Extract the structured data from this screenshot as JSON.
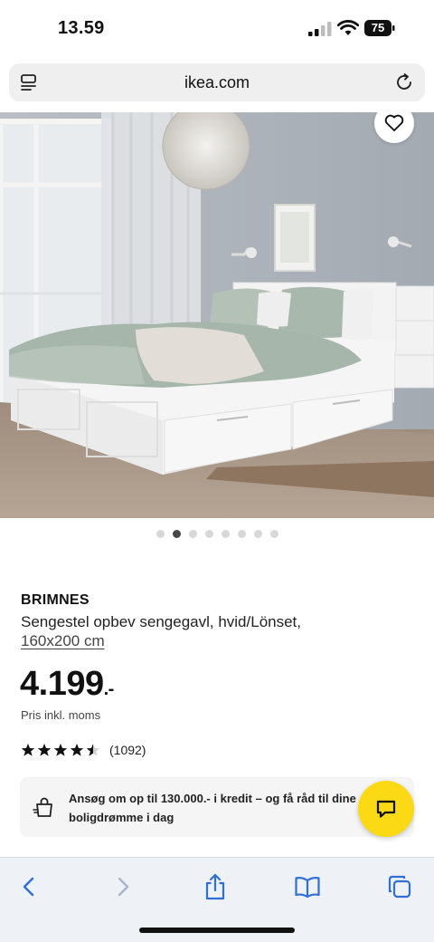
{
  "status_bar": {
    "time": "13.59",
    "battery": "75"
  },
  "browser": {
    "url": "ikea.com"
  },
  "gallery": {
    "total_dots": 8,
    "active_index": 1
  },
  "product": {
    "brand": "BRIMNES",
    "description": "Sengestel opbev sengegavl, hvid/Lönset,",
    "size": "160x200 cm",
    "price_integer": "4.199",
    "price_decimal": ".-",
    "price_note": "Pris inkl. moms",
    "rating_value": 4.5,
    "rating_max": 5,
    "review_count": "(1092)"
  },
  "credit_banner": {
    "text": "Ansøg om op til 130.000.- i kredit – og få råd til dine boligdrømme i dag"
  },
  "colors": {
    "ikea_yellow": "#fbd914",
    "toolbar_accent": "#2f6fd6"
  },
  "icons": [
    "menu-icon",
    "reload-icon",
    "heart-icon",
    "chat-icon",
    "bag-icon",
    "back-icon",
    "forward-icon",
    "share-icon",
    "bookmarks-icon",
    "tabs-icon"
  ]
}
